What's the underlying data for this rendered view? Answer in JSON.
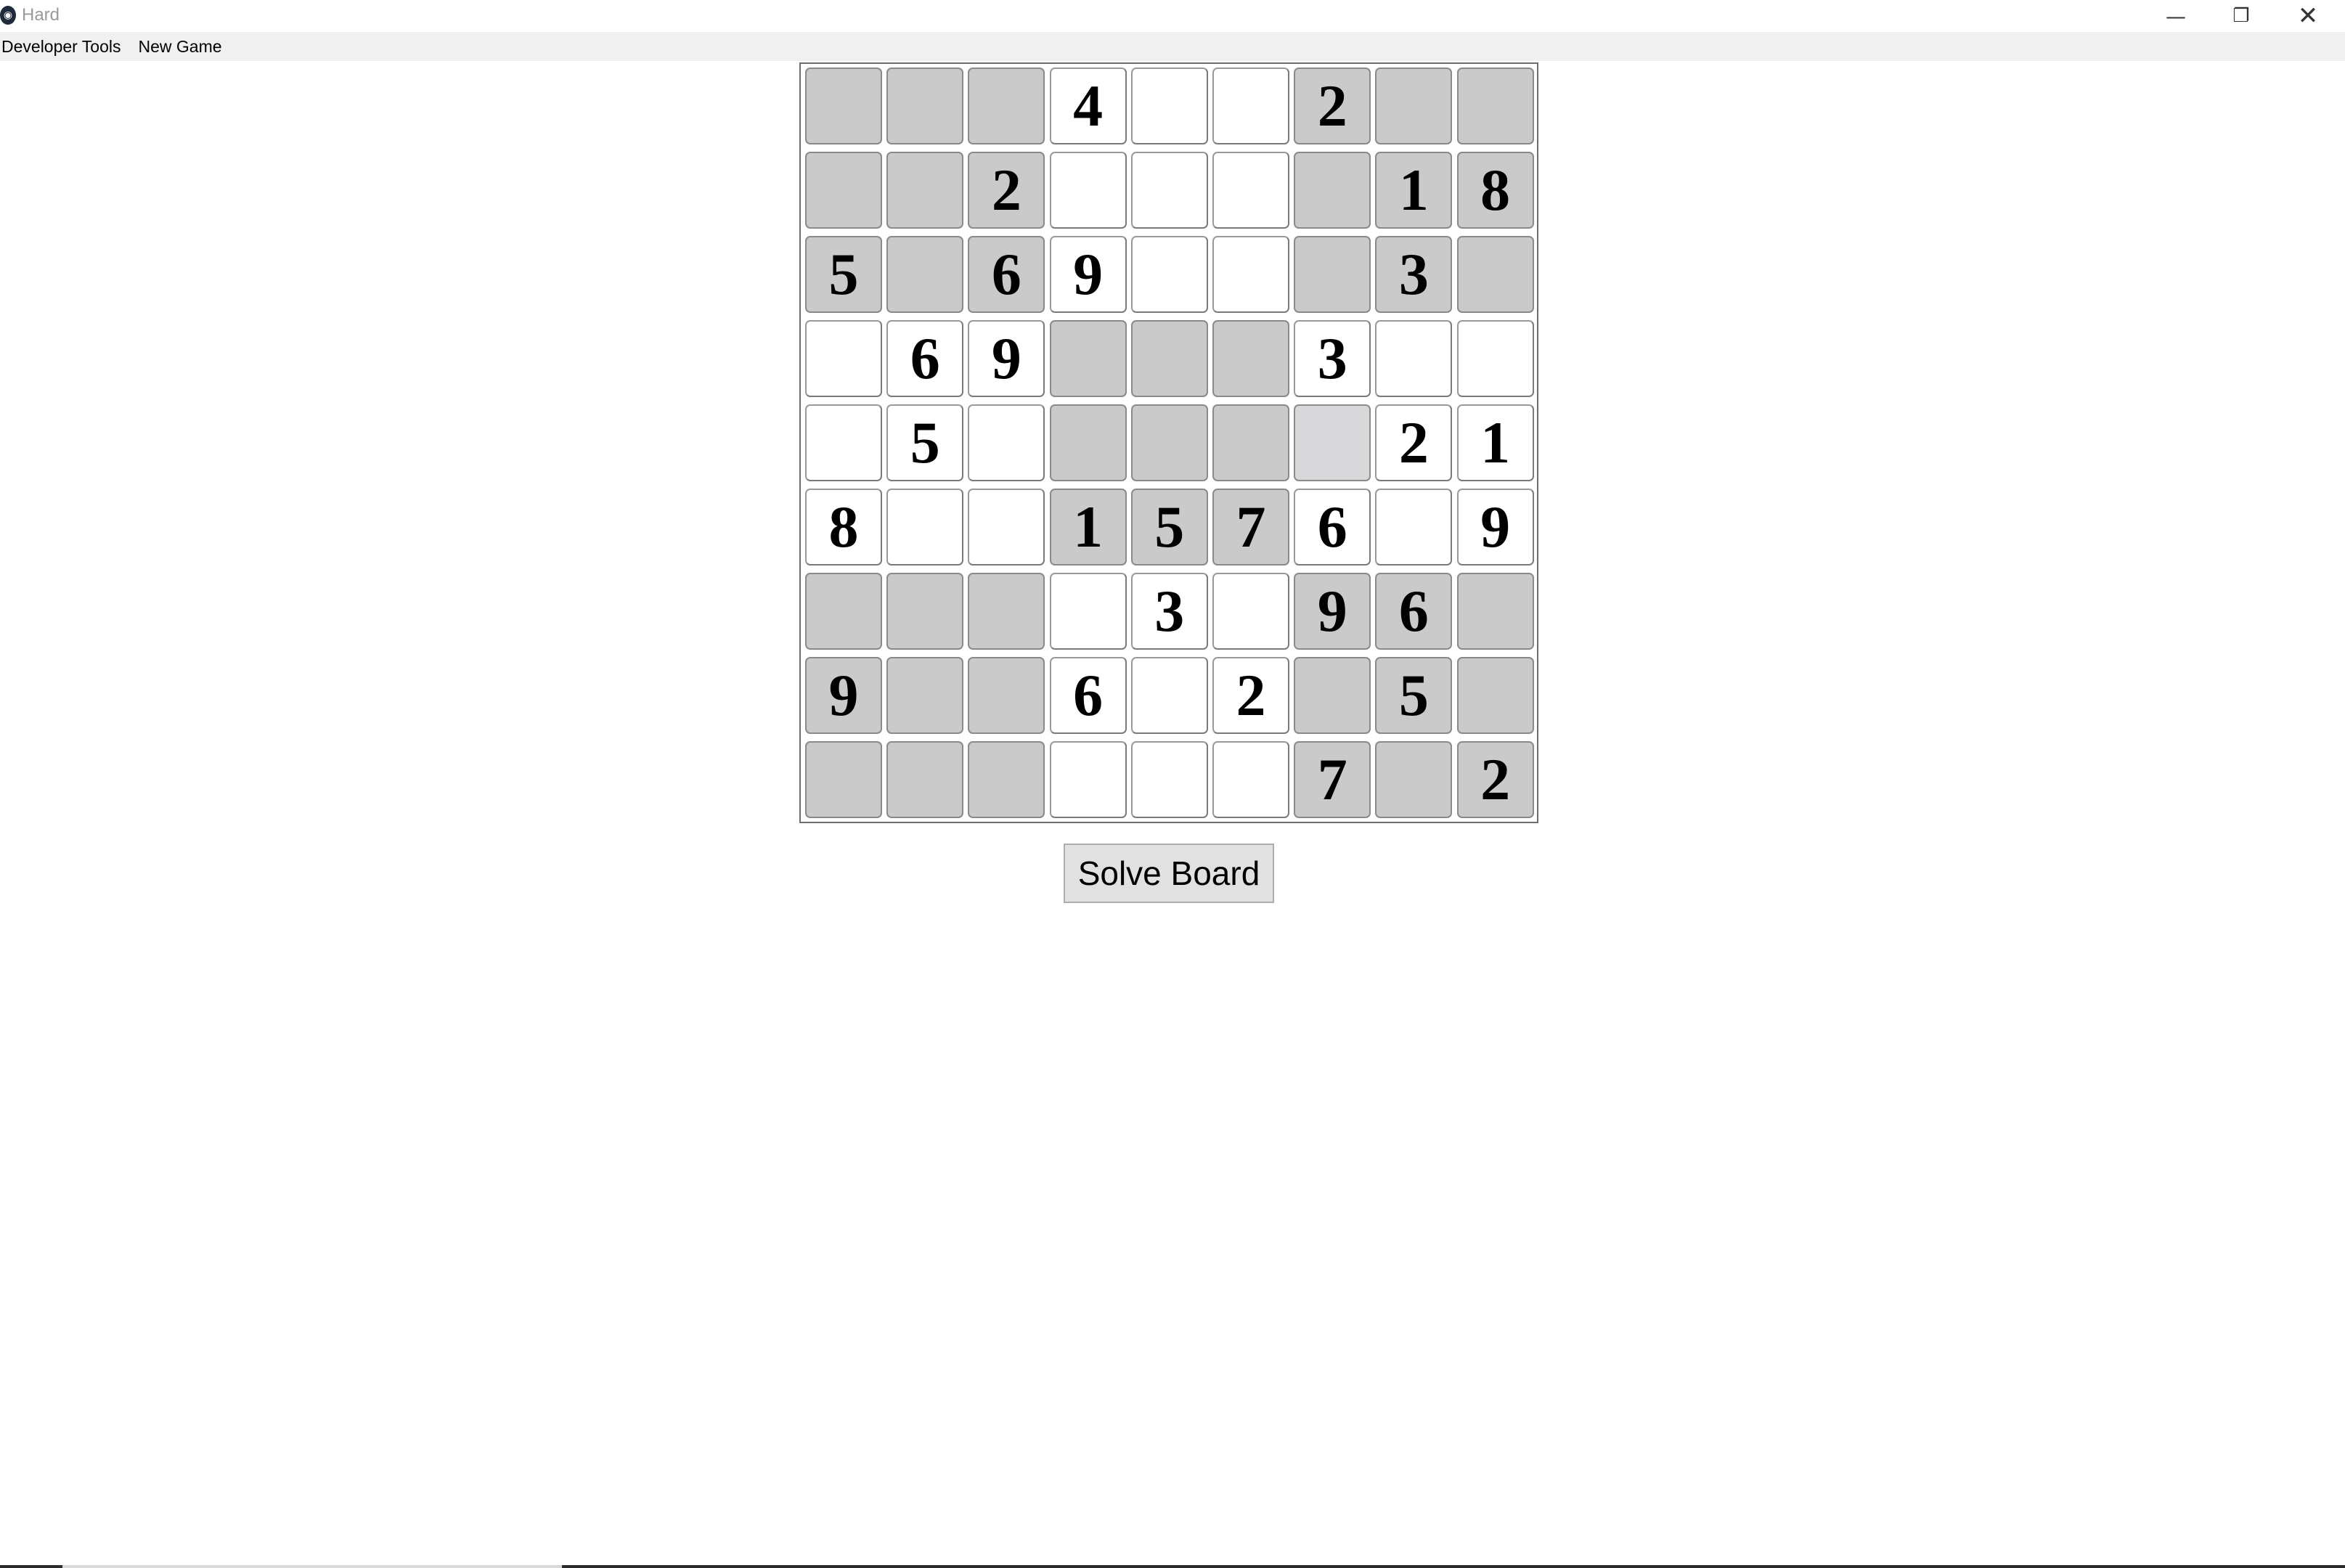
{
  "window": {
    "title": "Hard",
    "app_icon": "app-logo-icon",
    "controls": {
      "minimize_icon": "—",
      "maximize_icon": "❐",
      "close_icon": "✕"
    }
  },
  "menu": {
    "items": [
      {
        "label": "Developer Tools"
      },
      {
        "label": "New Game"
      }
    ]
  },
  "board": {
    "rows": [
      [
        "",
        "",
        "",
        "4",
        "",
        "",
        "2",
        "",
        ""
      ],
      [
        "",
        "",
        "2",
        "",
        "",
        "",
        "",
        "1",
        "8"
      ],
      [
        "5",
        "",
        "6",
        "9",
        "",
        "",
        "",
        "3",
        ""
      ],
      [
        "",
        "6",
        "9",
        "",
        "",
        "",
        "3",
        "",
        ""
      ],
      [
        "",
        "5",
        "",
        "",
        "",
        "",
        "",
        "2",
        "1"
      ],
      [
        "8",
        "",
        "",
        "1",
        "5",
        "7",
        "6",
        "",
        "9"
      ],
      [
        "",
        "",
        "",
        "",
        "3",
        "",
        "9",
        "6",
        ""
      ],
      [
        "9",
        "",
        "",
        "6",
        "",
        "2",
        "",
        "5",
        ""
      ],
      [
        "",
        "",
        "",
        "",
        "",
        "",
        "7",
        "",
        "2"
      ]
    ],
    "shading": [
      [
        "g",
        "g",
        "g",
        "w",
        "w",
        "w",
        "g",
        "g",
        "g"
      ],
      [
        "g",
        "g",
        "g",
        "w",
        "w",
        "w",
        "g",
        "g",
        "g"
      ],
      [
        "g",
        "g",
        "g",
        "w",
        "w",
        "w",
        "g",
        "g",
        "g"
      ],
      [
        "w",
        "w",
        "w",
        "g",
        "g",
        "g",
        "w",
        "w",
        "w"
      ],
      [
        "w",
        "w",
        "w",
        "g",
        "g",
        "g",
        "s",
        "w",
        "w"
      ],
      [
        "w",
        "w",
        "w",
        "g",
        "g",
        "g",
        "w",
        "w",
        "w"
      ],
      [
        "g",
        "g",
        "g",
        "w",
        "w",
        "w",
        "g",
        "g",
        "g"
      ],
      [
        "g",
        "g",
        "g",
        "w",
        "w",
        "w",
        "g",
        "g",
        "g"
      ],
      [
        "g",
        "g",
        "g",
        "w",
        "w",
        "w",
        "g",
        "g",
        "g"
      ]
    ],
    "colors": {
      "gray": "#cacaca",
      "white": "#ffffff",
      "selected": "#d8d8da"
    }
  },
  "actions": {
    "solve_label": "Solve Board"
  }
}
